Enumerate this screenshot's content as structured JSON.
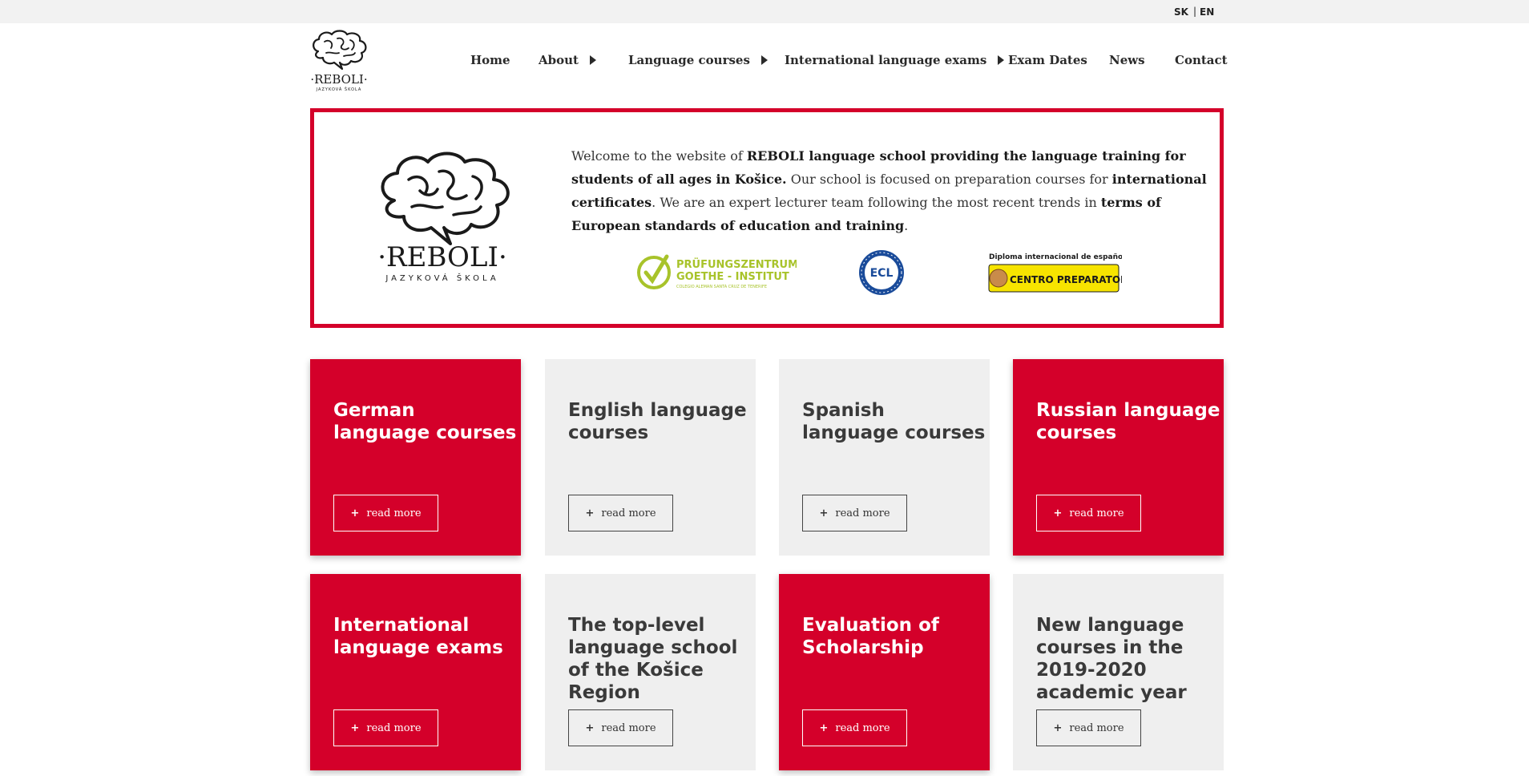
{
  "lang_switch": {
    "sk": "SK",
    "separator": "|",
    "en": "EN"
  },
  "brand": {
    "name": "·REBOLI·",
    "tagline": "JAZYKOVÁ ŠKOLA",
    "accent_color": "#d4002a"
  },
  "nav": {
    "home": "Home",
    "about": "About",
    "courses": "Language courses",
    "exams": "International language exams",
    "dates": "Exam Dates",
    "news": "News",
    "contact": "Contact"
  },
  "intro": {
    "p1": "Welcome to the website of ",
    "b1": "REBOLI language school providing the language training for students of all ages in Košice.",
    "p2": " Our school is focused on preparation courses for ",
    "b2": "international certificates",
    "p3": ". We are an expert lecturer team following the most recent trends in ",
    "b3": "terms of European standards of education and training",
    "p4": "."
  },
  "badges": {
    "goethe_line1": "PRÜFUNGSZENTRUM",
    "goethe_line2": "GOETHE - INSTITUT",
    "goethe_line3": "COLEGIO ALEMAN SANTA CRUZ DE TENERIFE",
    "ecl": "ECL",
    "dele_top": "Diploma internacional de español",
    "dele_main": "CENTRO PREPARATORIO"
  },
  "tiles": [
    {
      "title_l1": "German",
      "title_l2": "language courses",
      "title_l3": "",
      "title_l4": "",
      "button": "read more"
    },
    {
      "title_l1": "English language",
      "title_l2": "courses",
      "title_l3": "",
      "title_l4": "",
      "button": "read more"
    },
    {
      "title_l1": "Spanish",
      "title_l2": "language courses",
      "title_l3": "",
      "title_l4": "",
      "button": "read more"
    },
    {
      "title_l1": "Russian language",
      "title_l2": "courses",
      "title_l3": "",
      "title_l4": "",
      "button": "read more"
    },
    {
      "title_l1": "International",
      "title_l2": "language exams",
      "title_l3": "",
      "title_l4": "",
      "button": "read more"
    },
    {
      "title_l1": "The top-level",
      "title_l2": "language school",
      "title_l3": "of the Košice",
      "title_l4": "Region",
      "button": "read more"
    },
    {
      "title_l1": "Evaluation of",
      "title_l2": "Scholarship",
      "title_l3": "",
      "title_l4": "",
      "button": "read more"
    },
    {
      "title_l1": "New language",
      "title_l2": "courses in the",
      "title_l3": "2019-2020",
      "title_l4": "academic year",
      "button": "read more"
    }
  ],
  "plus_symbol": "+"
}
